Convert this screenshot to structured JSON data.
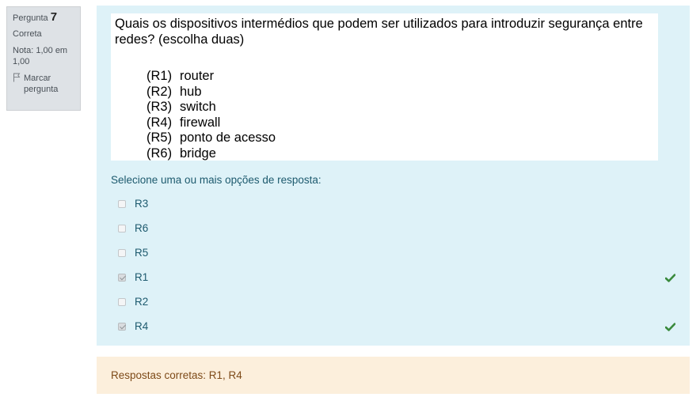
{
  "info": {
    "question_label": "Pergunta",
    "question_number": "7",
    "state": "Correta",
    "grade": "Nota: 1,00 em 1,00",
    "flag_label": "Marcar pergunta"
  },
  "question": {
    "text": "Quais os dispositivos intermédios que podem ser utilizados para introduzir segurança entre redes? (escolha duas)",
    "options": [
      {
        "code": "(R1)",
        "label": "router"
      },
      {
        "code": "(R2)",
        "label": "hub"
      },
      {
        "code": "(R3)",
        "label": "switch"
      },
      {
        "code": "(R4)",
        "label": "firewall"
      },
      {
        "code": "(R5)",
        "label": "ponto de acesso"
      },
      {
        "code": "(R6)",
        "label": "bridge"
      }
    ]
  },
  "answer_prompt": "Selecione uma ou mais opções de resposta:",
  "answers": [
    {
      "label": "R3",
      "checked": false,
      "correct": false
    },
    {
      "label": "R6",
      "checked": false,
      "correct": false
    },
    {
      "label": "R5",
      "checked": false,
      "correct": false
    },
    {
      "label": "R1",
      "checked": true,
      "correct": true
    },
    {
      "label": "R2",
      "checked": false,
      "correct": false
    },
    {
      "label": "R4",
      "checked": true,
      "correct": true
    }
  ],
  "feedback": {
    "right_answer": "Respostas corretas: R1, R4"
  },
  "colors": {
    "info_bg": "#dee2e6",
    "content_bg": "#def2f8",
    "outcome_bg": "#fcefdc",
    "correct_tick": "#3a8a3d",
    "answer_text": "#1d5a6e",
    "outcome_text": "#7d4a18"
  }
}
